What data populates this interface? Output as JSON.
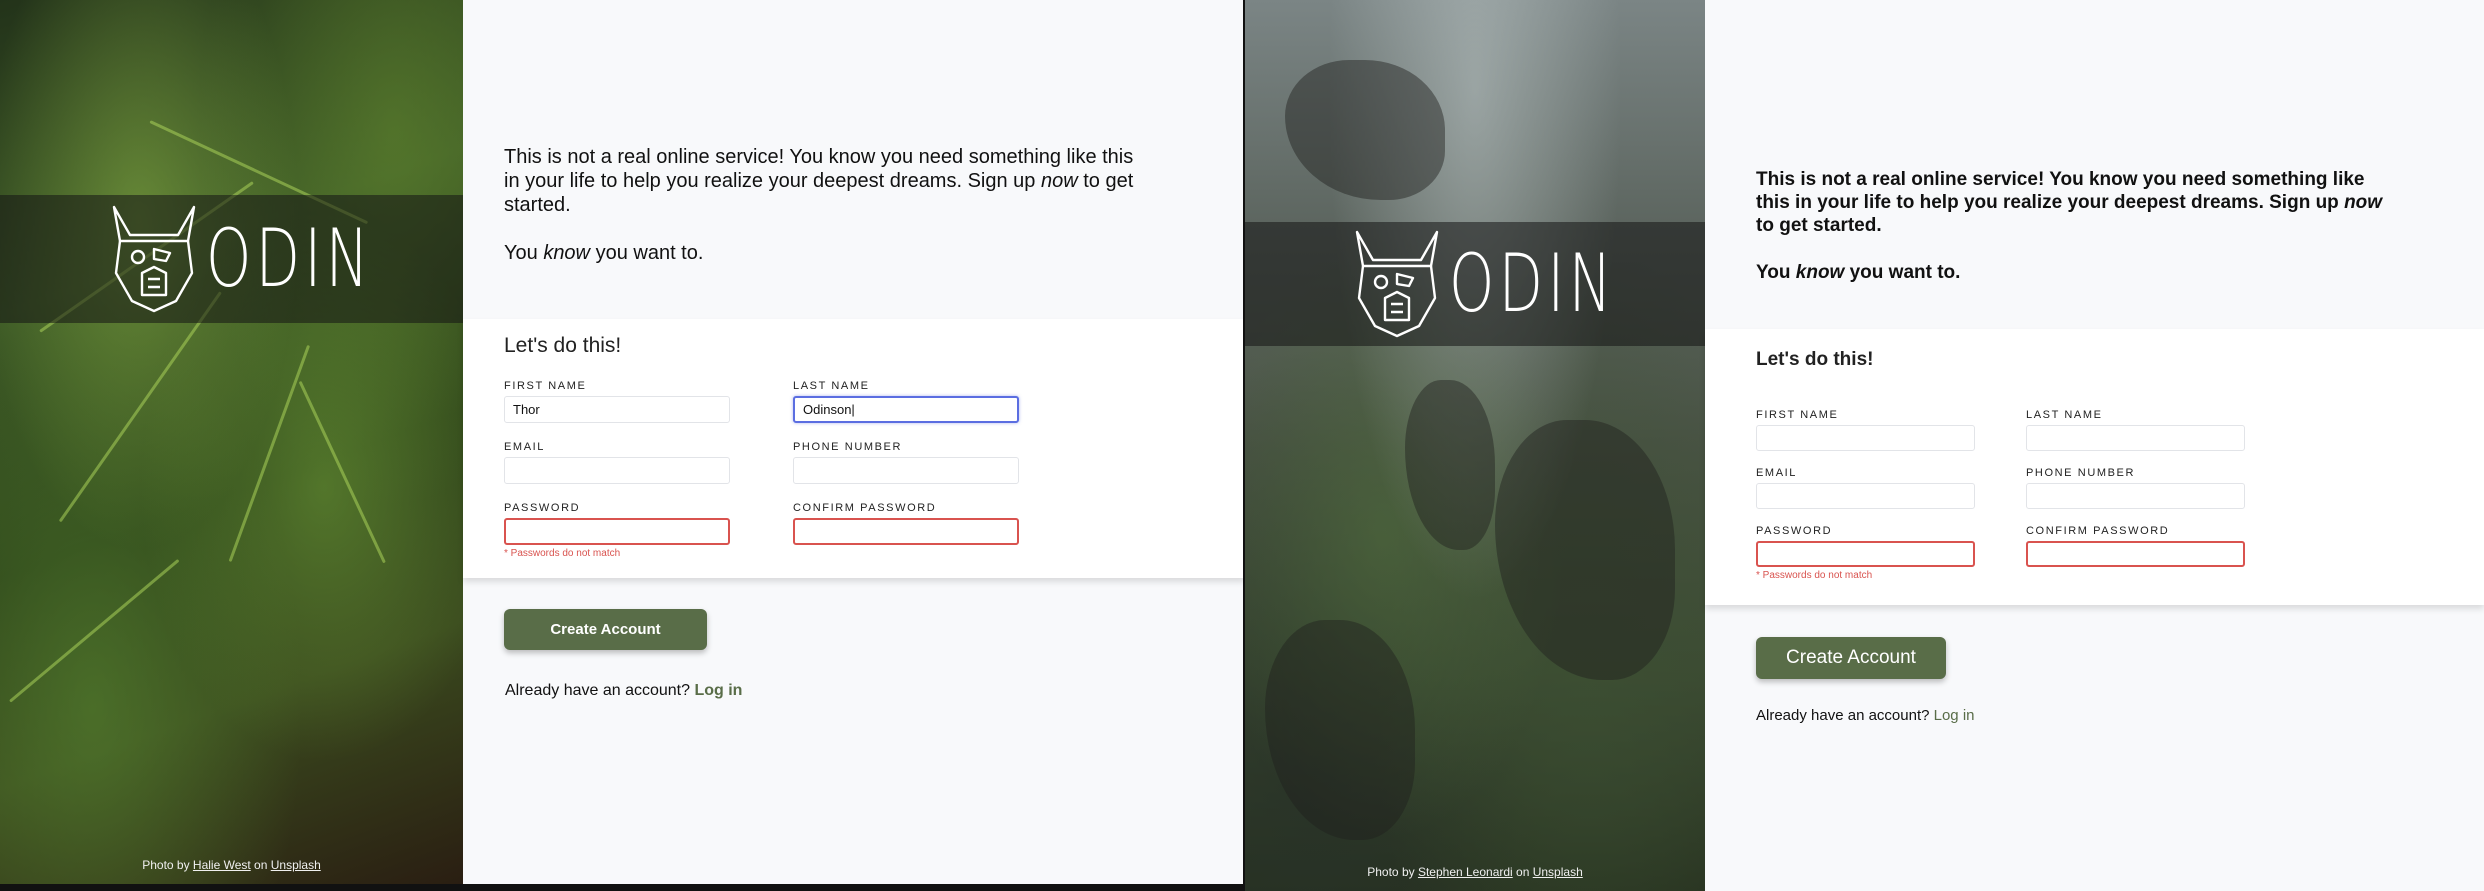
{
  "left": {
    "brand": "ODIN",
    "intro": {
      "line1_pre": "This is not a real online service! You know you need something like this in your life to help you realize your deepest dreams. Sign up ",
      "line1_em": "now",
      "line1_post": " to get started.",
      "line2_pre": "You ",
      "line2_em": "know",
      "line2_post": " you want to."
    },
    "form_title": "Let's do this!",
    "fields": {
      "first_name": {
        "label": "FIRST NAME",
        "value": "Thor"
      },
      "last_name": {
        "label": "LAST NAME",
        "value": "Odinson|"
      },
      "email": {
        "label": "EMAIL",
        "value": ""
      },
      "phone": {
        "label": "PHONE NUMBER",
        "value": ""
      },
      "password": {
        "label": "PASSWORD",
        "value": "",
        "error": "* Passwords do not match"
      },
      "confirm_password": {
        "label": "CONFIRM PASSWORD",
        "value": ""
      }
    },
    "submit_label": "Create Account",
    "login_prompt": "Already have an account? ",
    "login_link": "Log in",
    "credit": {
      "prefix": "Photo by ",
      "author": "Halie West",
      "mid": " on ",
      "site": "Unsplash"
    }
  },
  "right": {
    "brand": "ODIN",
    "intro": {
      "line1_pre": "This is not a real online service! You know you need something like this in your life to help you realize your deepest dreams. Sign up ",
      "line1_em": "now",
      "line1_post": " to get started.",
      "line2_pre": "You ",
      "line2_em": "know",
      "line2_post": " you want to."
    },
    "form_title": "Let's do this!",
    "fields": {
      "first_name": {
        "label": "FIRST NAME",
        "value": ""
      },
      "last_name": {
        "label": "LAST NAME",
        "value": ""
      },
      "email": {
        "label": "EMAIL",
        "value": ""
      },
      "phone": {
        "label": "PHONE NUMBER",
        "value": ""
      },
      "password": {
        "label": "PASSWORD",
        "value": "",
        "error": "* Passwords do not match"
      },
      "confirm_password": {
        "label": "CONFIRM PASSWORD",
        "value": ""
      }
    },
    "submit_label": "Create Account",
    "login_prompt": "Already have an account? ",
    "login_link": "Log in",
    "credit": {
      "prefix": "Photo by ",
      "author": "Stephen Leonardi",
      "mid": " on ",
      "site": "Unsplash"
    }
  },
  "colors": {
    "accent_green": "#596d48",
    "error_red": "#d9534f",
    "focus_blue": "#5b6ee1",
    "page_bg": "#f8f9fb"
  }
}
